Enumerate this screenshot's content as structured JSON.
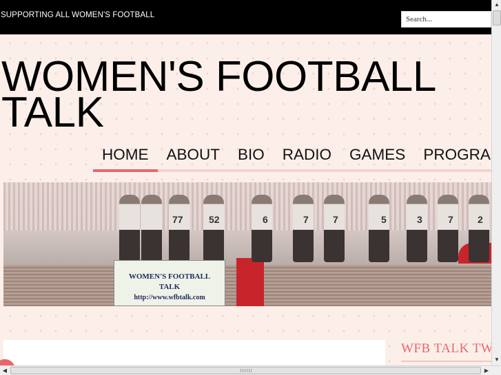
{
  "header": {
    "tagline": "SUPPORTING  ALL WOMEN'S FOOTBALL",
    "search_placeholder": "Search..."
  },
  "site": {
    "title_line1": "WOMEN'S FOOTBALL",
    "title_line2": "TALK"
  },
  "nav": {
    "items": [
      {
        "label": "HOME",
        "active": true
      },
      {
        "label": "ABOUT",
        "active": false
      },
      {
        "label": "BIO",
        "active": false
      },
      {
        "label": "RADIO",
        "active": false
      },
      {
        "label": "GAMES",
        "active": false
      },
      {
        "label": "PROGRA",
        "active": false
      }
    ]
  },
  "banner": {
    "sign_line1": "WOMEN'S FOOTBALL",
    "sign_line2": "TALK",
    "sign_url": "http://www.wfbtalk.com",
    "jerseys": [
      "77",
      "52",
      "6",
      "7",
      "7",
      "5",
      "3",
      "7",
      "2"
    ]
  },
  "sidebar": {
    "widget_title": "WFB TALK TW"
  },
  "colors": {
    "accent": "#e8676b",
    "topbar": "#000000",
    "background": "#fcefe9"
  }
}
